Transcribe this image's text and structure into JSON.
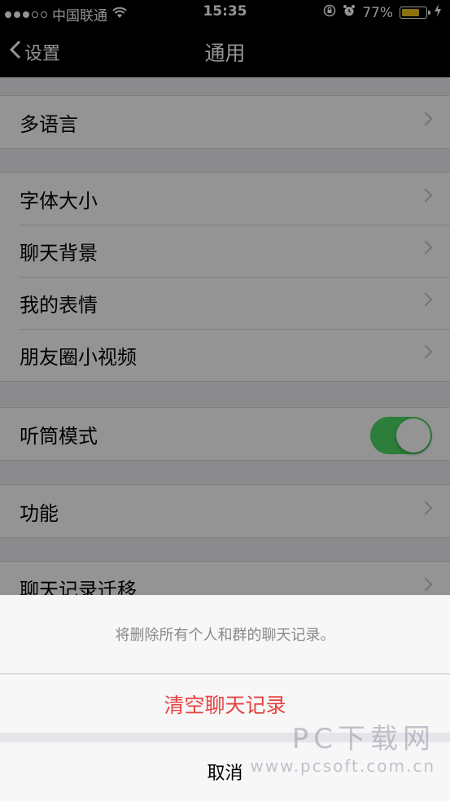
{
  "status_bar": {
    "carrier": "中国联通",
    "time": "15:35",
    "battery_percent": "77%",
    "battery_level": 0.77
  },
  "nav": {
    "back_label": "设置",
    "title": "通用"
  },
  "groups": [
    {
      "items": [
        {
          "label": "多语言"
        }
      ]
    },
    {
      "items": [
        {
          "label": "字体大小"
        },
        {
          "label": "聊天背景"
        },
        {
          "label": "我的表情"
        },
        {
          "label": "朋友圈小视频"
        }
      ]
    },
    {
      "items": [
        {
          "label": "听筒模式",
          "toggle_on": true
        }
      ]
    },
    {
      "items": [
        {
          "label": "功能"
        }
      ]
    },
    {
      "items": [
        {
          "label": "聊天记录迁移"
        }
      ]
    }
  ],
  "action_sheet": {
    "message": "将删除所有个人和群的聊天记录。",
    "destructive_label": "清空聊天记录",
    "cancel_label": "取消"
  },
  "watermark": {
    "big": "PC下载网",
    "small": "www.pcsoft.com.cn"
  },
  "colors": {
    "toggle_on": "#4cd964",
    "destructive": "#e64340",
    "battery": "#f0c419"
  }
}
